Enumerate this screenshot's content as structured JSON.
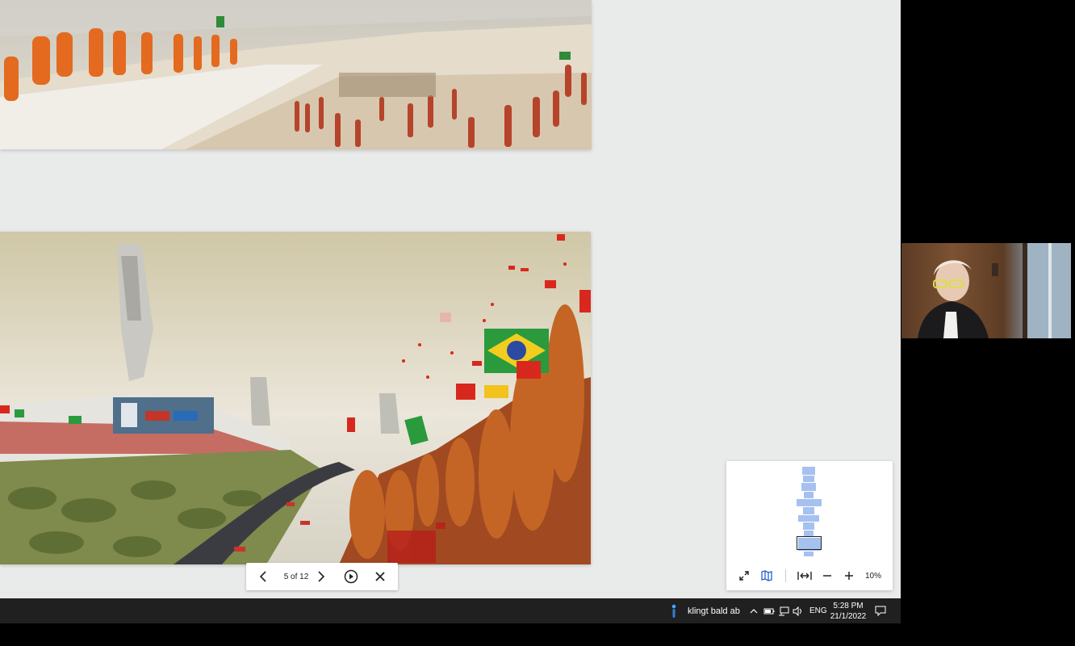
{
  "viewer": {
    "page_counter": "5 of 12",
    "zoom": "10%",
    "total_pages": 12,
    "current_page": 5
  },
  "icons": {
    "prev": "chevron-left-icon",
    "next": "chevron-right-icon",
    "play": "play-circle-icon",
    "close": "close-icon",
    "expand": "expand-icon",
    "map": "map-icon",
    "fit_width": "fit-width-icon",
    "zoom_out": "minus-icon",
    "zoom_in": "plus-icon"
  },
  "taskbar": {
    "notification_text": "klingt bald ab",
    "language": "ENG",
    "time": "5:28 PM",
    "date": "21/1/2022"
  },
  "colors": {
    "thumb": "#a6c1f0",
    "taskbar": "#202020",
    "background": "#e9eaea"
  }
}
